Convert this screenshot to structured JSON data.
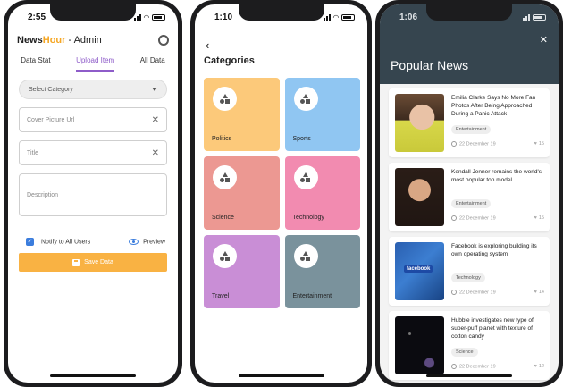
{
  "phone1": {
    "time": "2:55",
    "brand": {
      "part1": "News",
      "part2": "Hour",
      "part3": " - Admin"
    },
    "tabs": [
      {
        "label": "Data Stat",
        "active": false
      },
      {
        "label": "Upload Item",
        "active": true
      },
      {
        "label": "All Data",
        "active": false
      }
    ],
    "select_category_placeholder": "Select Category",
    "fields": {
      "cover_placeholder": "Cover Picture Url",
      "title_placeholder": "Title",
      "description_placeholder": "Description"
    },
    "notify_label": "Notify to All Users",
    "notify_checked": true,
    "preview_label": "Preview",
    "save_label": "Save Data",
    "accent_color": "#8e5cc9",
    "save_color": "#f9b243"
  },
  "phone2": {
    "time": "1:10",
    "title": "Categories",
    "categories": [
      {
        "label": "Politics",
        "color": "#fcc97a"
      },
      {
        "label": "Sports",
        "color": "#90c6f2"
      },
      {
        "label": "Science",
        "color": "#ec9892"
      },
      {
        "label": "Technology",
        "color": "#f28bb0"
      },
      {
        "label": "Travel",
        "color": "#c98ed6"
      },
      {
        "label": "Entertainment",
        "color": "#7a929c"
      }
    ]
  },
  "phone3": {
    "time": "1:06",
    "title": "Popular News",
    "header_color": "#36454f",
    "news": [
      {
        "title": "Emilia Clarke Says No More Fan Photos After Being Approached During a Panic Attack",
        "tag": "Entertainment",
        "date": "22 December 19",
        "likes": "15"
      },
      {
        "title": "Kendall Jenner remains the world's most popular top model",
        "tag": "Entertainment",
        "date": "22 December 19",
        "likes": "15"
      },
      {
        "title": "Facebook is exploring building its own operating system",
        "tag": "Technology",
        "date": "22 December 19",
        "likes": "14",
        "thumb_text": "facebook"
      },
      {
        "title": "Hubble investigates new type of super-puff planet with texture of cotton candy",
        "tag": "Science",
        "date": "22 December 19",
        "likes": "12"
      }
    ]
  }
}
